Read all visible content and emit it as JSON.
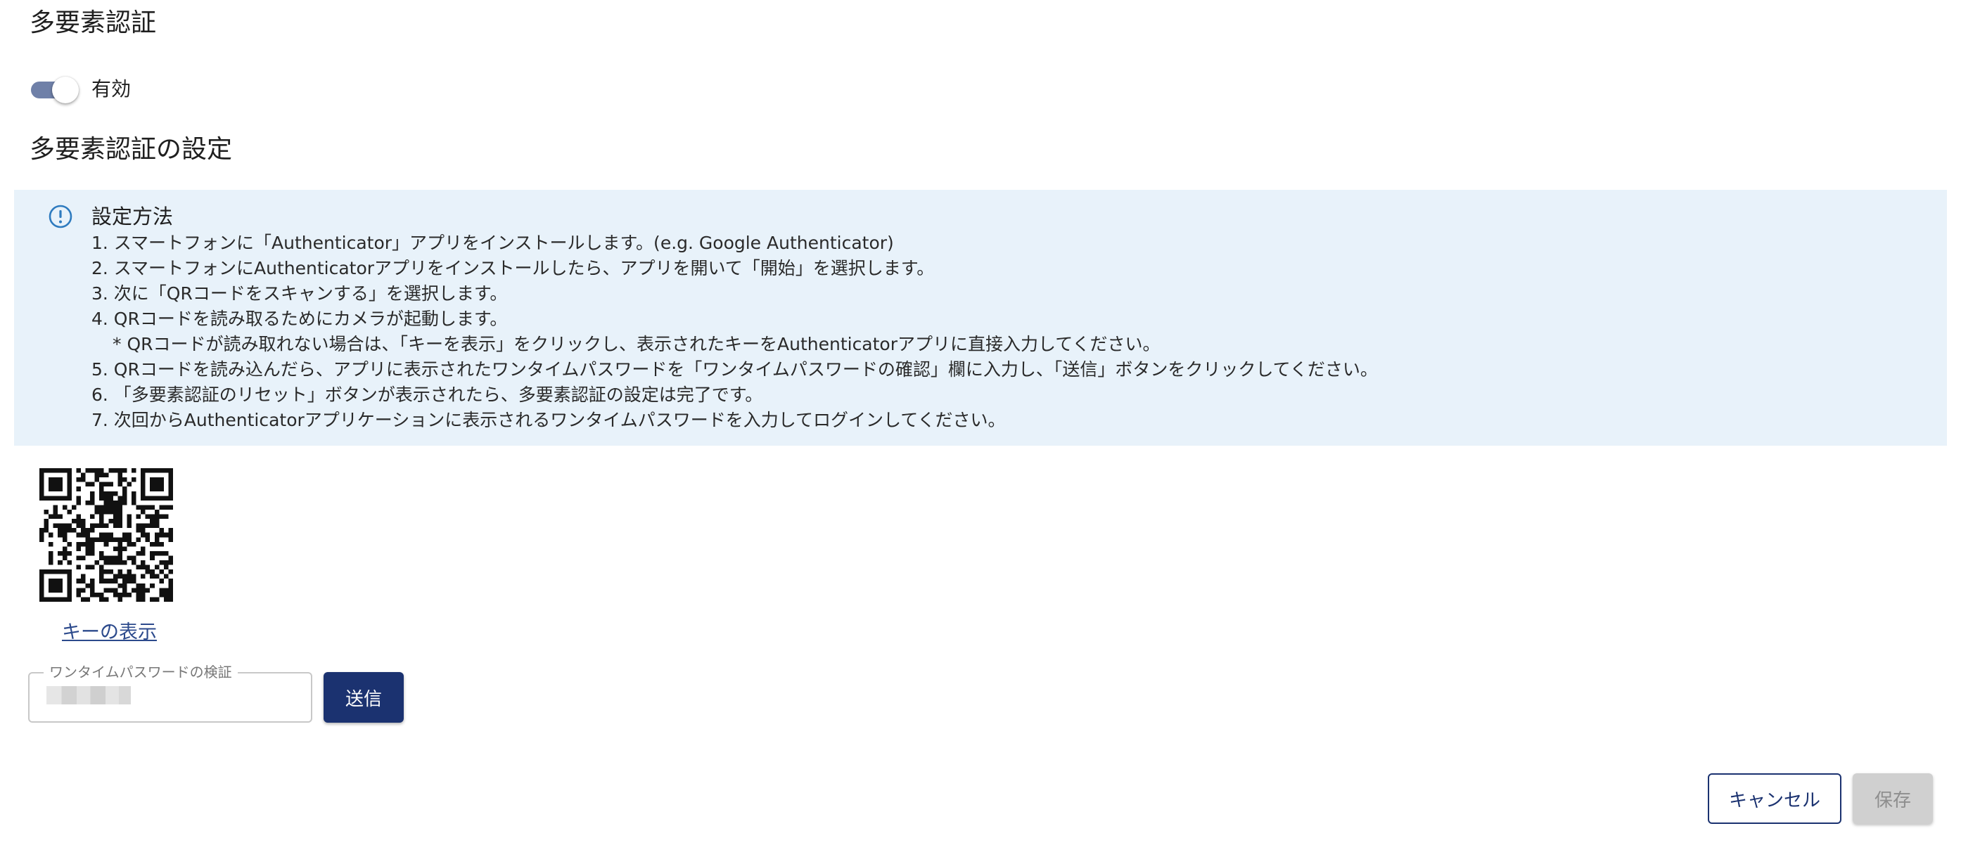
{
  "mfa": {
    "title": "多要素認証",
    "toggle": {
      "label": "有効",
      "enabled": true,
      "track_color": "#6f80a8"
    }
  },
  "setup": {
    "title": "多要素認証の設定",
    "info": {
      "icon": "info-circle-icon",
      "title": "設定方法",
      "steps": [
        "1. スマートフォンに「Authenticator」アプリをインストールします。(e.g. Google Authenticator)",
        "2. スマートフォンにAuthenticatorアプリをインストールしたら、アプリを開いて「開始」を選択します。",
        "3. 次に「QRコードをスキャンする」を選択します。",
        "4. QRコードを読み取るためにカメラが起動します。",
        "* QRコードが読み取れない場合は、「キーを表示」をクリックし、表示されたキーをAuthenticatorアプリに直接入力してください。",
        "5. QRコードを読み込んだら、アプリに表示されたワンタイムパスワードを「ワンタイムパスワードの確認」欄に入力し、「送信」ボタンをクリックしてください。",
        "6. 「多要素認証のリセット」ボタンが表示されたら、多要素認証の設定は完了です。",
        "7. 次回からAuthenticatorアプリケーションに表示されるワンタイムパスワードを入力してログインしてください。"
      ]
    },
    "show_key_link": "キーの表示",
    "otp": {
      "label": "ワンタイムパスワードの検証",
      "value": ""
    },
    "send_button": "送信"
  },
  "footer": {
    "cancel_button": "キャンセル",
    "save_button": "保存"
  },
  "colors": {
    "primary": "#1b3270",
    "info_bg": "#e8f2fa",
    "disabled_bg": "#d0d0d0",
    "link": "#2c4a8c"
  }
}
